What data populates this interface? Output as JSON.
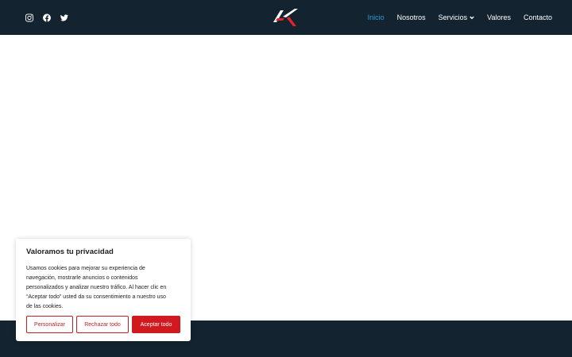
{
  "header": {
    "social": [
      {
        "icon": "instagram-icon"
      },
      {
        "icon": "facebook-icon"
      },
      {
        "icon": "twitter-icon"
      }
    ],
    "logo_colors": {
      "dark": "#ffffff",
      "accent": "#e3242b"
    },
    "nav": [
      {
        "label": "Inicio",
        "active": true
      },
      {
        "label": "Nosotros",
        "active": false
      },
      {
        "label": "Servicios",
        "active": false,
        "dropdown": true
      },
      {
        "label": "Valores",
        "active": false
      },
      {
        "label": "Contacto",
        "active": false
      }
    ]
  },
  "colors": {
    "header_bg": "#13232f",
    "active_link": "#2a9fd8",
    "accent_red": "#d11a1f"
  },
  "cookie": {
    "title": "Valoramos tu privacidad",
    "text_lines": [
      "Usamos cookies para mejorar su experiencia de",
      "navegación, mostrarle anuncios o contenidos",
      "personalizados y analizar nuestro tráfico. Al hacer clic en",
      "“Aceptar todo” usted da su consentimiento a nuestro uso",
      "de las cookies."
    ],
    "customize_label": "Personalizar",
    "reject_label": "Rechazar todo",
    "accept_label": "Aceptar todo"
  }
}
